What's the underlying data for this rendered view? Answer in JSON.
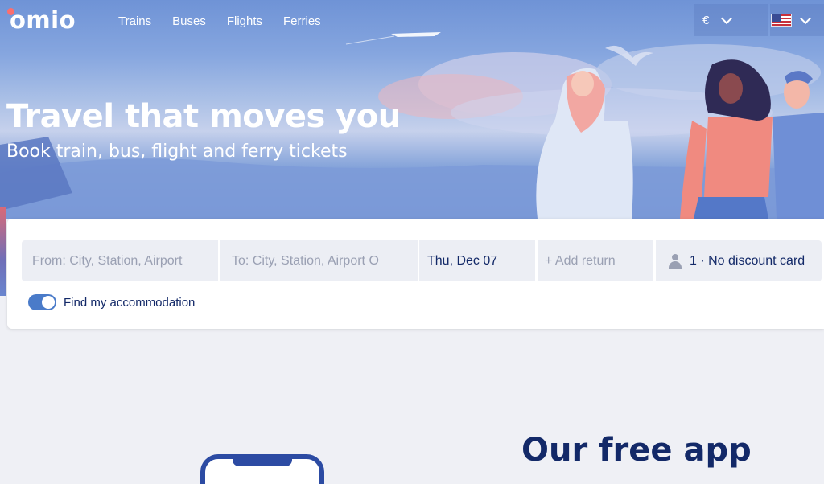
{
  "brand": {
    "logo_text": "omio"
  },
  "nav": {
    "links": [
      "Trains",
      "Buses",
      "Flights",
      "Ferries"
    ],
    "currency": "€",
    "language_flag": "us-flag-icon"
  },
  "hero": {
    "title": "Travel that moves you",
    "subtitle": "Book train, bus, flight and ferry tickets"
  },
  "search": {
    "from_placeholder": "From: City, Station, Airport",
    "to_placeholder": "To: City, Station, Airport O",
    "date": "Thu, Dec 07",
    "add_return": "+ Add return",
    "passengers": "1 · No discount card",
    "accommodation_label": "Find my accommodation",
    "accommodation_enabled": true
  },
  "app_section": {
    "heading": "Our free app"
  },
  "colors": {
    "brand_navy": "#132968",
    "accent_blue": "#4a7bc9",
    "logo_dot": "#fc6f6f",
    "page_bg": "#eff0f5"
  }
}
